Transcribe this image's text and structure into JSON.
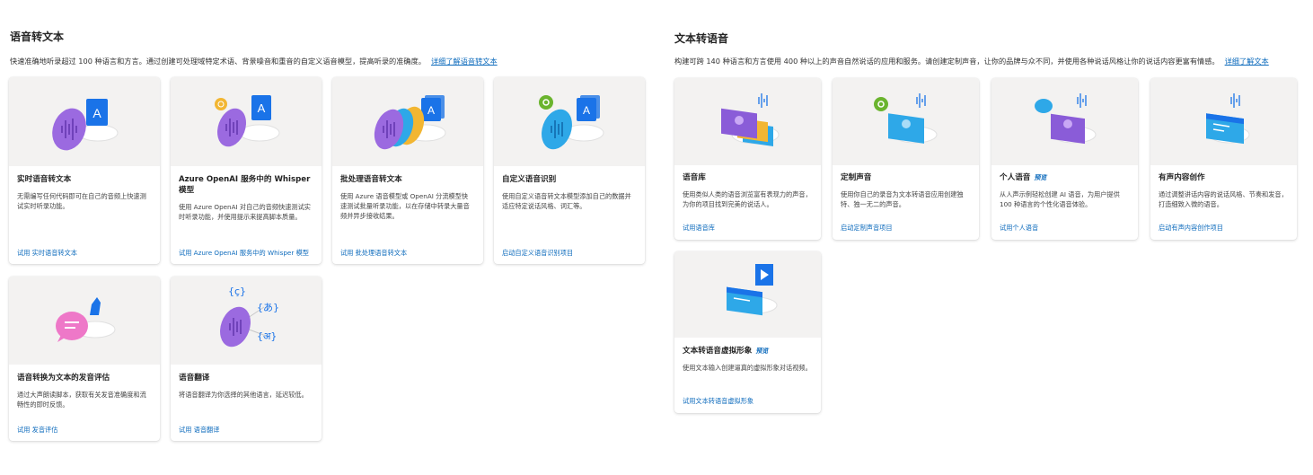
{
  "stt": {
    "title": "语音转文本",
    "description": "快速准确地听录超过 100 种语言和方言。通过创建可处理域特定术语、背景噪音和重音的自定义语音模型，提高听录的准确度。",
    "learn_more": "详细了解语音转文本",
    "cards": [
      {
        "title": "实时语音转文本",
        "description": "无需编写任何代码即可在自己的音频上快速测试实时听录功能。",
        "link": "试用 实时语音转文本"
      },
      {
        "title": "Azure OpenAI 服务中的 Whisper 模型",
        "description": "使用 Azure OpenAI 对自己的音频快速测试实时听录功能，并使用提示来提高脚本质量。",
        "link": "试用 Azure OpenAI 服务中的 Whisper 模型"
      },
      {
        "title": "批处理语音转文本",
        "description": "使用 Azure 语音模型或 OpenAI 分流模型快速测试批量听录功能，以在存储中转录大量音频并异步接收结果。",
        "link": "试用 批处理语音转文本"
      },
      {
        "title": "自定义语音识别",
        "description": "使用自定义语音转文本模型添加自己的数据并适应特定说话风格、词汇等。",
        "link": "启动自定义语音识别项目"
      },
      {
        "title": "语音转换为文本的发音评估",
        "description": "通过大声朗读脚本，获取有关发音准确度和流畅性的即时反馈。",
        "link": "试用 发音评估"
      },
      {
        "title": "语音翻译",
        "description": "将语音翻译为你选择的其他语言，延迟较低。",
        "link": "试用 语音翻译"
      }
    ]
  },
  "tts": {
    "title": "文本转语音",
    "description": "构建可跨 140 种语言和方言使用 400 种以上的声音自然说话的应用和服务。请创建定制声音，让你的品牌与众不同，并使用各种说话风格让你的说话内容更富有情感。",
    "learn_more": "详细了解文本",
    "cards": [
      {
        "title": "语音库",
        "description": "使用类似人类的语音浏览富有表现力的声音，为你的项目找到完美的说话人。",
        "link": "试用语音库"
      },
      {
        "title": "定制声音",
        "description": "使用你自己的录音为文本转语音应用创建独特、独一无二的声音。",
        "link": "启动定制声音项目"
      },
      {
        "title": "个人语音",
        "badge": "预览",
        "description": "从人声示例轻松创建 AI 语音，为用户提供 100 种语言的个性化语音体验。",
        "link": "试用个人语音"
      },
      {
        "title": "有声内容创作",
        "description": "通过调整讲话内容的说话风格、节奏和发音，打造细致入微的语音。",
        "link": "启动有声内容创作项目"
      },
      {
        "title": "文本转语音虚拟形象",
        "badge": "预览",
        "description": "使用文本输入创建逼真的虚拟形象对话视频。",
        "link": "试用文本转语音虚拟形象"
      }
    ]
  },
  "icons": {
    "text_tile_glyph": "A",
    "translate_glyphs": [
      "{ç}",
      "{あ}",
      "{अ}"
    ]
  },
  "colors": {
    "link": "#0f6cbd",
    "purple": "#8a5cd8",
    "blue": "#1a73e8",
    "green": "#6ab42e",
    "pink": "#ee78c8",
    "cyan": "#2ea8e8"
  }
}
